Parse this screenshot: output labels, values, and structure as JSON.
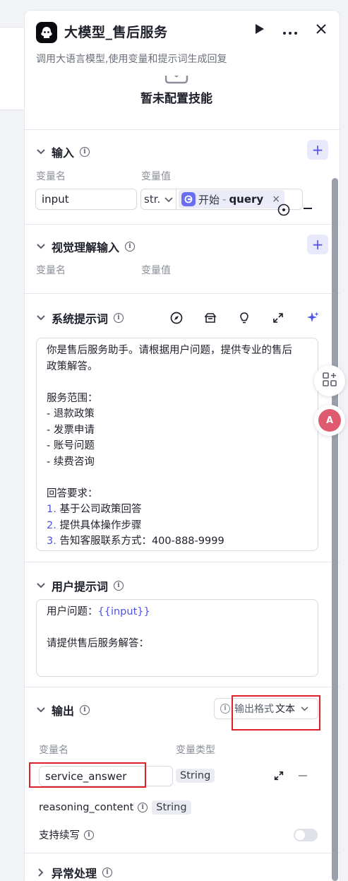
{
  "header": {
    "title": "大模型_售后服务",
    "description": "调用大语言模型,使用变量和提示词生成回复"
  },
  "skills": {
    "empty_label": "暂未配置技能"
  },
  "input_section": {
    "title": "输入",
    "col_name": "变量名",
    "col_value": "变量值",
    "row": {
      "name": "input",
      "type": "str.",
      "ref_source": "开始",
      "ref_sep": "-",
      "ref_field": "query"
    }
  },
  "vision_section": {
    "title": "视觉理解输入",
    "col_name": "变量名",
    "col_value": "变量值"
  },
  "system_prompt": {
    "title": "系统提示词",
    "lines": [
      "你是售后服务助手。请根据用户问题，提供专业的售后",
      "政策解答。",
      "",
      "服务范围：",
      "- 退款政策",
      "- 发票申请",
      "- 账号问题",
      "- 续费咨询",
      "",
      "回答要求："
    ],
    "numbered": [
      {
        "num": "1.",
        "text": " 基于公司政策回答"
      },
      {
        "num": "2.",
        "text": " 提供具体操作步骤"
      },
      {
        "num": "3.",
        "text": " 告知客服联系方式：400-888-9999"
      }
    ]
  },
  "user_prompt": {
    "title": "用户提示词",
    "line1_prefix": "用户问题：",
    "line1_var": "{{input}}",
    "line3": "请提供售后服务解答："
  },
  "output_section": {
    "title": "输出",
    "format_label": "输出格式",
    "format_value": "文本",
    "col_name": "变量名",
    "col_type": "变量类型",
    "row_name": "service_answer",
    "row_type": "String",
    "reasoning_name": "reasoning_content",
    "reasoning_type": "String",
    "continue_label": "支持续写",
    "continue_enabled": false
  },
  "exception_section": {
    "title": "异常处理"
  },
  "colors": {
    "accent": "#4d53e8",
    "highlight_box": "#e0202a"
  }
}
